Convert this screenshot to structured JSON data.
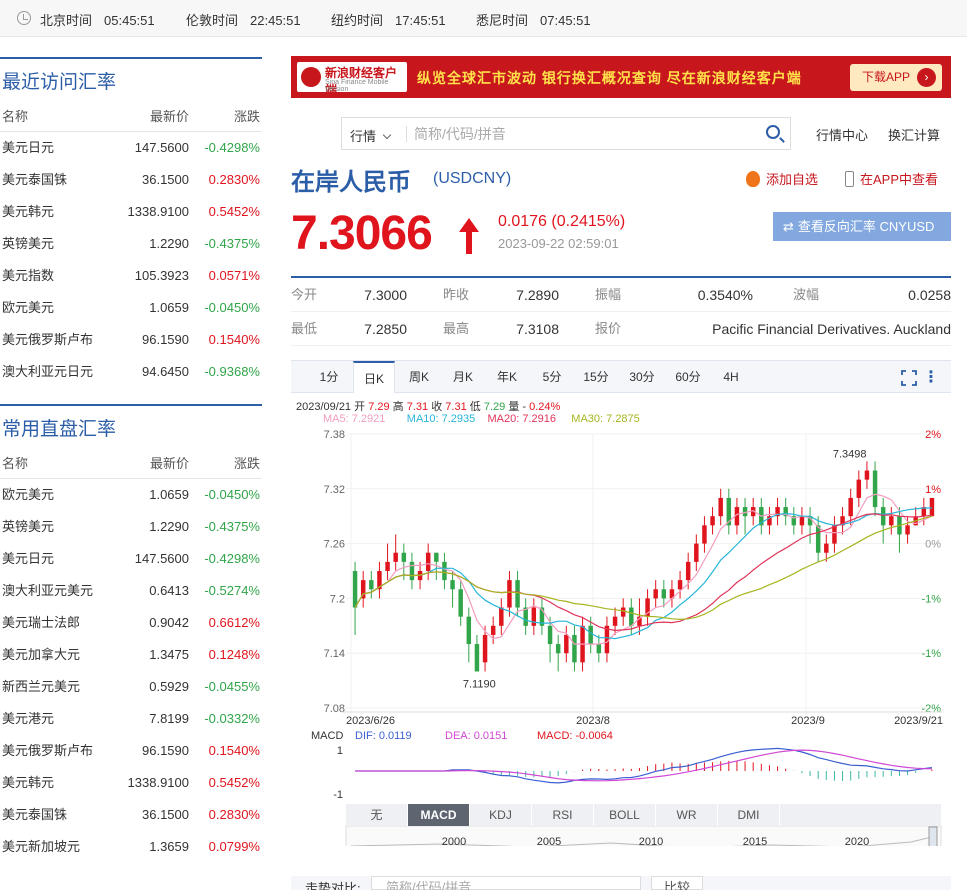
{
  "topbar": {
    "zones": [
      {
        "city": "北京时间",
        "time": "05:45:51"
      },
      {
        "city": "伦敦时间",
        "time": "22:45:51"
      },
      {
        "city": "纽约时间",
        "time": "17:45:51"
      },
      {
        "city": "悉尼时间",
        "time": "07:45:51"
      }
    ]
  },
  "recent": {
    "title": "最近访问汇率",
    "headers": {
      "name": "名称",
      "price": "最新价",
      "change": "涨跌"
    },
    "rows": [
      {
        "name": "美元日元",
        "price": "147.5600",
        "change": "-0.4298%"
      },
      {
        "name": "美元泰国铢",
        "price": "36.1500",
        "change": "0.2830%"
      },
      {
        "name": "美元韩元",
        "price": "1338.9100",
        "change": "0.5452%"
      },
      {
        "name": "英镑美元",
        "price": "1.2290",
        "change": "-0.4375%"
      },
      {
        "name": "美元指数",
        "price": "105.3923",
        "change": "0.0571%"
      },
      {
        "name": "欧元美元",
        "price": "1.0659",
        "change": "-0.0450%"
      },
      {
        "name": "美元俄罗斯卢布",
        "price": "96.1590",
        "change": "0.1540%"
      },
      {
        "name": "澳大利亚元日元",
        "price": "94.6450",
        "change": "-0.9368%"
      }
    ]
  },
  "common": {
    "title": "常用直盘汇率",
    "headers": {
      "name": "名称",
      "price": "最新价",
      "change": "涨跌"
    },
    "rows": [
      {
        "name": "欧元美元",
        "price": "1.0659",
        "change": "-0.0450%"
      },
      {
        "name": "英镑美元",
        "price": "1.2290",
        "change": "-0.4375%"
      },
      {
        "name": "美元日元",
        "price": "147.5600",
        "change": "-0.4298%"
      },
      {
        "name": "澳大利亚元美元",
        "price": "0.6413",
        "change": "-0.5274%"
      },
      {
        "name": "美元瑞士法郎",
        "price": "0.9042",
        "change": "0.6612%"
      },
      {
        "name": "美元加拿大元",
        "price": "1.3475",
        "change": "0.1248%"
      },
      {
        "name": "新西兰元美元",
        "price": "0.5929",
        "change": "-0.0455%"
      },
      {
        "name": "美元港元",
        "price": "7.8199",
        "change": "-0.0332%"
      },
      {
        "name": "美元俄罗斯卢布",
        "price": "96.1590",
        "change": "0.1540%"
      },
      {
        "name": "美元韩元",
        "price": "1338.9100",
        "change": "0.5452%"
      },
      {
        "name": "美元泰国铢",
        "price": "36.1500",
        "change": "0.2830%"
      },
      {
        "name": "美元新加坡元",
        "price": "1.3659",
        "change": "0.0799%"
      }
    ]
  },
  "banner": {
    "logo_text": "新浪财经客户端",
    "logo_sub": "Sina Finance Mobile Version",
    "slogan": "纵览全球汇市波动  银行换汇概况查询  尽在新浪财经客户端",
    "download": "下载APP"
  },
  "search": {
    "select": "行情",
    "placeholder": "简称/代码/拼音",
    "links": [
      "行情中心",
      "换汇计算"
    ]
  },
  "quote": {
    "name": "在岸人民币",
    "code": "(USDCNY)",
    "add_fav": "添加自选",
    "view_app": "在APP中查看",
    "price": "7.3066",
    "change": "0.0176 (0.2415%)",
    "timestamp": "2023-09-22 02:59:01",
    "reverse": "查看反向汇率 CNYUSD",
    "stats": [
      [
        {
          "label": "今开",
          "value": "7.3000"
        },
        {
          "label": "昨收",
          "value": "7.2890"
        },
        {
          "label": "振幅",
          "value": "0.3540%"
        },
        {
          "label": "波幅",
          "value": "0.0258"
        }
      ],
      [
        {
          "label": "最低",
          "value": "7.2850"
        },
        {
          "label": "最高",
          "value": "7.3108"
        },
        {
          "label": "报价",
          "value": "Pacific Financial Derivatives. Auckland"
        }
      ]
    ]
  },
  "chart_tabs": [
    "1分",
    "日K",
    "周K",
    "月K",
    "年K",
    "5分",
    "15分",
    "30分",
    "60分",
    "4H"
  ],
  "chart_info": {
    "date": "2023/09/21",
    "open_label": "开",
    "open": "7.29",
    "high_label": "高",
    "high": "7.31",
    "close_label": "收",
    "close": "7.31",
    "low_label": "低",
    "low": "7.29",
    "volume_label": "量",
    "volume": "-",
    "pct": "0.24%",
    "ma5": "MA5: 7.2921",
    "ma10": "MA10: 7.2935",
    "ma20": "MA20: 7.2916",
    "ma30": "MA30: 7.2875",
    "macd_label": "MACD",
    "dif": "DIF: 0.0119",
    "dea": "DEA: 0.0151",
    "macd": "MACD: -0.0064"
  },
  "indicators": [
    "无",
    "MACD",
    "KDJ",
    "RSI",
    "BOLL",
    "WR",
    "DMI"
  ],
  "compare": {
    "label": "走势对比:",
    "placeholder": "简称/代码/拼音",
    "button": "比较"
  },
  "colors": {
    "up": "#e0141d",
    "down": "#31a54a",
    "accent": "#2c5ea8",
    "ma5": "#f29dc0",
    "ma10": "#27b5d8",
    "ma20": "#e0345a",
    "ma30": "#a7b51f"
  },
  "chart_data": {
    "type": "candlestick",
    "y_ticks": [
      "7.38",
      "7.32",
      "7.26",
      "7.2",
      "7.14",
      "7.08"
    ],
    "y_right_ticks": [
      "2%",
      "1%",
      "0%",
      "-1%",
      "-1%",
      "-2%"
    ],
    "ylim": [
      7.08,
      7.38
    ],
    "x_labels": [
      "2023/6/26",
      "2023/8",
      "2023/9",
      "2023/9/21"
    ],
    "annotations": [
      "7.3498",
      "7.1190"
    ],
    "macd_ticks": [
      "1",
      "-1"
    ],
    "timeline_years": [
      "2000",
      "2005",
      "2010",
      "2015",
      "2020"
    ],
    "candles": [
      [
        7.23,
        7.19,
        7.24,
        7.16
      ],
      [
        7.2,
        7.22,
        7.23,
        7.19
      ],
      [
        7.22,
        7.21,
        7.23,
        7.2
      ],
      [
        7.21,
        7.23,
        7.24,
        7.2
      ],
      [
        7.23,
        7.24,
        7.26,
        7.22
      ],
      [
        7.24,
        7.25,
        7.27,
        7.23
      ],
      [
        7.25,
        7.24,
        7.26,
        7.22
      ],
      [
        7.24,
        7.22,
        7.25,
        7.21
      ],
      [
        7.22,
        7.23,
        7.24,
        7.21
      ],
      [
        7.23,
        7.25,
        7.26,
        7.22
      ],
      [
        7.25,
        7.24,
        7.25,
        7.22
      ],
      [
        7.24,
        7.22,
        7.25,
        7.21
      ],
      [
        7.22,
        7.21,
        7.23,
        7.19
      ],
      [
        7.21,
        7.18,
        7.22,
        7.17
      ],
      [
        7.18,
        7.15,
        7.19,
        7.13
      ],
      [
        7.15,
        7.12,
        7.16,
        7.12
      ],
      [
        7.13,
        7.16,
        7.17,
        7.12
      ],
      [
        7.16,
        7.17,
        7.18,
        7.15
      ],
      [
        7.17,
        7.19,
        7.2,
        7.16
      ],
      [
        7.19,
        7.22,
        7.23,
        7.18
      ],
      [
        7.22,
        7.19,
        7.23,
        7.18
      ],
      [
        7.19,
        7.17,
        7.2,
        7.16
      ],
      [
        7.17,
        7.19,
        7.2,
        7.16
      ],
      [
        7.19,
        7.17,
        7.2,
        7.16
      ],
      [
        7.17,
        7.15,
        7.18,
        7.13
      ],
      [
        7.15,
        7.14,
        7.16,
        7.12
      ],
      [
        7.14,
        7.16,
        7.17,
        7.13
      ],
      [
        7.16,
        7.13,
        7.17,
        7.12
      ],
      [
        7.13,
        7.17,
        7.18,
        7.12
      ],
      [
        7.17,
        7.15,
        7.18,
        7.14
      ],
      [
        7.15,
        7.14,
        7.16,
        7.13
      ],
      [
        7.14,
        7.17,
        7.18,
        7.13
      ],
      [
        7.17,
        7.18,
        7.19,
        7.16
      ],
      [
        7.18,
        7.19,
        7.2,
        7.17
      ],
      [
        7.19,
        7.17,
        7.2,
        7.16
      ],
      [
        7.17,
        7.18,
        7.2,
        7.16
      ],
      [
        7.18,
        7.2,
        7.21,
        7.17
      ],
      [
        7.2,
        7.21,
        7.22,
        7.19
      ],
      [
        7.21,
        7.2,
        7.22,
        7.19
      ],
      [
        7.2,
        7.21,
        7.22,
        7.19
      ],
      [
        7.21,
        7.22,
        7.23,
        7.2
      ],
      [
        7.22,
        7.24,
        7.25,
        7.21
      ],
      [
        7.24,
        7.26,
        7.27,
        7.23
      ],
      [
        7.26,
        7.28,
        7.29,
        7.25
      ],
      [
        7.28,
        7.29,
        7.3,
        7.27
      ],
      [
        7.29,
        7.31,
        7.32,
        7.28
      ],
      [
        7.31,
        7.28,
        7.32,
        7.27
      ],
      [
        7.28,
        7.3,
        7.31,
        7.27
      ],
      [
        7.3,
        7.29,
        7.31,
        7.27
      ],
      [
        7.29,
        7.3,
        7.31,
        7.28
      ],
      [
        7.3,
        7.28,
        7.31,
        7.27
      ],
      [
        7.28,
        7.29,
        7.3,
        7.27
      ],
      [
        7.29,
        7.3,
        7.31,
        7.28
      ],
      [
        7.3,
        7.29,
        7.31,
        7.28
      ],
      [
        7.29,
        7.28,
        7.3,
        7.27
      ],
      [
        7.28,
        7.29,
        7.3,
        7.27
      ],
      [
        7.29,
        7.28,
        7.3,
        7.26
      ],
      [
        7.28,
        7.25,
        7.29,
        7.24
      ],
      [
        7.25,
        7.26,
        7.27,
        7.24
      ],
      [
        7.26,
        7.28,
        7.29,
        7.25
      ],
      [
        7.28,
        7.29,
        7.3,
        7.27
      ],
      [
        7.29,
        7.31,
        7.32,
        7.28
      ],
      [
        7.31,
        7.33,
        7.34,
        7.3
      ],
      [
        7.33,
        7.34,
        7.35,
        7.32
      ],
      [
        7.34,
        7.3,
        7.35,
        7.29
      ],
      [
        7.3,
        7.28,
        7.31,
        7.26
      ],
      [
        7.28,
        7.29,
        7.3,
        7.27
      ],
      [
        7.29,
        7.27,
        7.3,
        7.25
      ],
      [
        7.27,
        7.28,
        7.29,
        7.26
      ],
      [
        7.28,
        7.29,
        7.3,
        7.28
      ],
      [
        7.29,
        7.3,
        7.31,
        7.28
      ],
      [
        7.29,
        7.31,
        7.31,
        7.29
      ]
    ]
  }
}
